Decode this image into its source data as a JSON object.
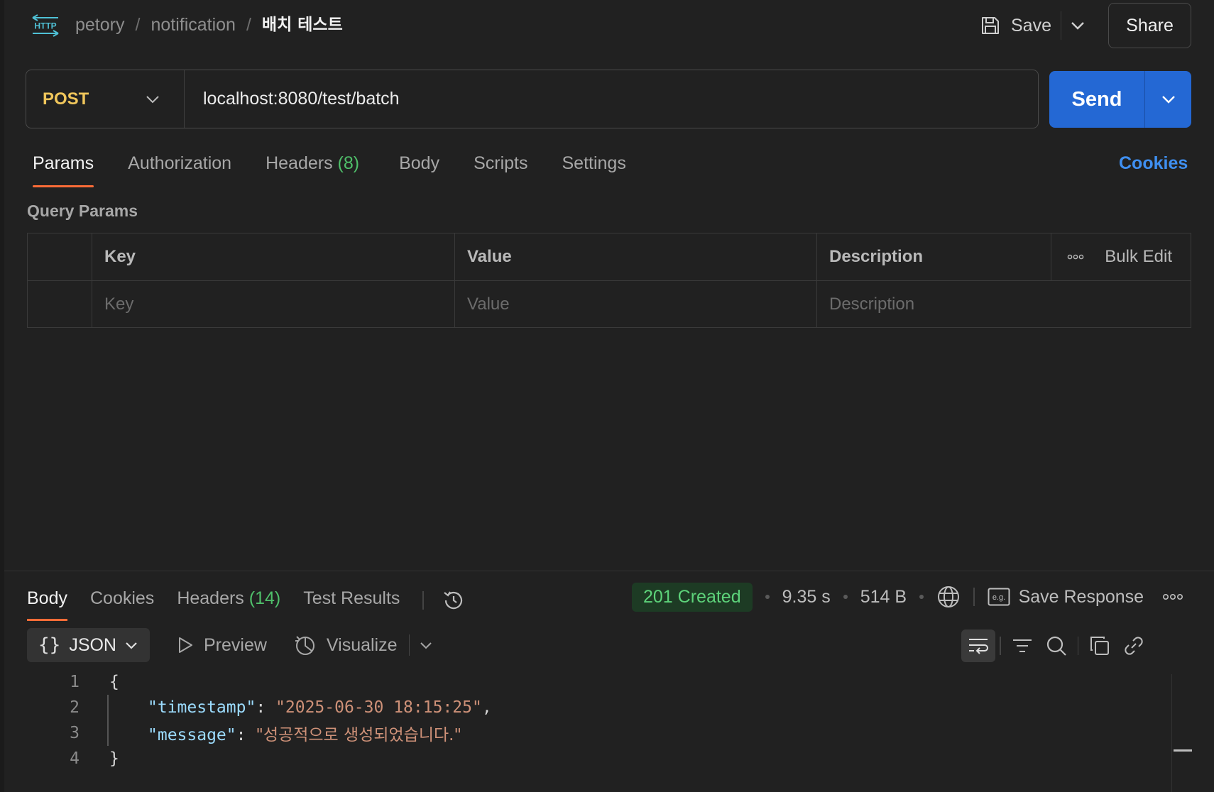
{
  "header": {
    "breadcrumb": [
      "petory",
      "notification",
      "배치 테스트"
    ],
    "separator": "/",
    "save_label": "Save",
    "share_label": "Share"
  },
  "request": {
    "method": "POST",
    "url": "localhost:8080/test/batch",
    "send_label": "Send"
  },
  "request_tabs": {
    "params": "Params",
    "authorization": "Authorization",
    "headers": "Headers",
    "headers_count": "(8)",
    "body": "Body",
    "scripts": "Scripts",
    "settings": "Settings",
    "cookies": "Cookies"
  },
  "query_params": {
    "title": "Query Params",
    "columns": [
      "Key",
      "Value",
      "Description"
    ],
    "bulk_edit": "Bulk Edit",
    "placeholders": {
      "key": "Key",
      "value": "Value",
      "description": "Description"
    }
  },
  "response_tabs": {
    "body": "Body",
    "cookies": "Cookies",
    "headers": "Headers",
    "headers_count": "(14)",
    "test_results": "Test Results"
  },
  "response_status": {
    "status": "201 Created",
    "time": "9.35 s",
    "size": "514 B",
    "save_response": "Save Response"
  },
  "format_bar": {
    "format": "JSON",
    "preview": "Preview",
    "visualize": "Visualize"
  },
  "response_body": {
    "line_numbers": [
      "1",
      "2",
      "3",
      "4"
    ],
    "open_brace": "{",
    "close_brace": "}",
    "line2_key": "\"timestamp\"",
    "line2_value": "\"2025-06-30 18:15:25\"",
    "line3_key": "\"message\"",
    "line3_value": "\"성공적으로 생성되었습니다.\"",
    "colon": ": ",
    "comma": ","
  },
  "colors": {
    "accent_orange": "#ff6c37",
    "send_blue": "#2468d4",
    "method_yellow": "#f0c65b",
    "status_green": "#5dd37a"
  }
}
